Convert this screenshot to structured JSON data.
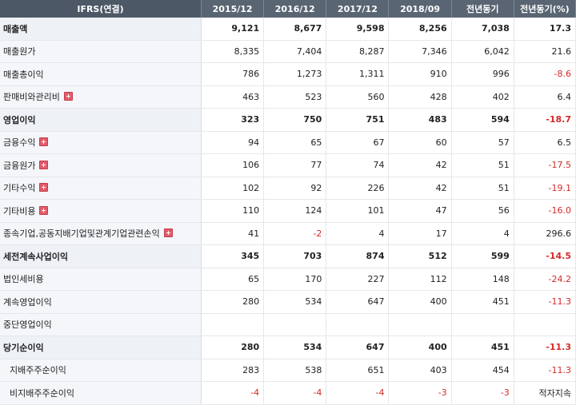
{
  "header": {
    "label": "IFRS(연결)",
    "columns": [
      "2015/12",
      "2016/12",
      "2017/12",
      "2018/09",
      "전년동기",
      "전년동기(%)"
    ]
  },
  "rows": [
    {
      "label": "매출액",
      "bold": true,
      "expand": false,
      "values": [
        "9,121",
        "8,677",
        "9,598",
        "8,256",
        "7,038",
        "17.3"
      ]
    },
    {
      "label": "매출원가",
      "bold": false,
      "expand": false,
      "values": [
        "8,335",
        "7,404",
        "8,287",
        "7,346",
        "6,042",
        "21.6"
      ]
    },
    {
      "label": "매출총이익",
      "bold": false,
      "expand": false,
      "values": [
        "786",
        "1,273",
        "1,311",
        "910",
        "996",
        "-8.6"
      ]
    },
    {
      "label": "판매비와관리비",
      "bold": false,
      "expand": true,
      "values": [
        "463",
        "523",
        "560",
        "428",
        "402",
        "6.4"
      ]
    },
    {
      "label": "영업이익",
      "bold": true,
      "expand": false,
      "values": [
        "323",
        "750",
        "751",
        "483",
        "594",
        "-18.7"
      ]
    },
    {
      "label": "금융수익",
      "bold": false,
      "expand": true,
      "values": [
        "94",
        "65",
        "67",
        "60",
        "57",
        "6.5"
      ]
    },
    {
      "label": "금융원가",
      "bold": false,
      "expand": true,
      "values": [
        "106",
        "77",
        "74",
        "42",
        "51",
        "-17.5"
      ]
    },
    {
      "label": "기타수익",
      "bold": false,
      "expand": true,
      "values": [
        "102",
        "92",
        "226",
        "42",
        "51",
        "-19.1"
      ]
    },
    {
      "label": "기타비용",
      "bold": false,
      "expand": true,
      "values": [
        "110",
        "124",
        "101",
        "47",
        "56",
        "-16.0"
      ]
    },
    {
      "label": "종속기업,공동지배기업및관계기업관련손익",
      "bold": false,
      "expand": true,
      "values": [
        "41",
        "-2",
        "4",
        "17",
        "4",
        "296.6"
      ]
    },
    {
      "label": "세전계속사업이익",
      "bold": true,
      "expand": false,
      "values": [
        "345",
        "703",
        "874",
        "512",
        "599",
        "-14.5"
      ]
    },
    {
      "label": "법인세비용",
      "bold": false,
      "expand": false,
      "values": [
        "65",
        "170",
        "227",
        "112",
        "148",
        "-24.2"
      ]
    },
    {
      "label": "계속영업이익",
      "bold": false,
      "expand": false,
      "values": [
        "280",
        "534",
        "647",
        "400",
        "451",
        "-11.3"
      ]
    },
    {
      "label": "중단영업이익",
      "bold": false,
      "expand": false,
      "values": [
        "",
        "",
        "",
        "",
        "",
        ""
      ]
    },
    {
      "label": "당기순이익",
      "bold": true,
      "expand": false,
      "values": [
        "280",
        "534",
        "647",
        "400",
        "451",
        "-11.3"
      ]
    },
    {
      "label": "지배주주순이익",
      "bold": false,
      "expand": false,
      "sub": true,
      "values": [
        "283",
        "538",
        "651",
        "403",
        "454",
        "-11.3"
      ]
    },
    {
      "label": "비지배주주순이익",
      "bold": false,
      "expand": false,
      "sub": true,
      "values": [
        "-4",
        "-4",
        "-4",
        "-3",
        "-3",
        "적자지속"
      ]
    }
  ],
  "colors": {
    "header_bg": "#5a6573",
    "label_bg": "#f4f6fa",
    "negative": "#d52a2a",
    "expand_icon": "#e35b6b"
  }
}
